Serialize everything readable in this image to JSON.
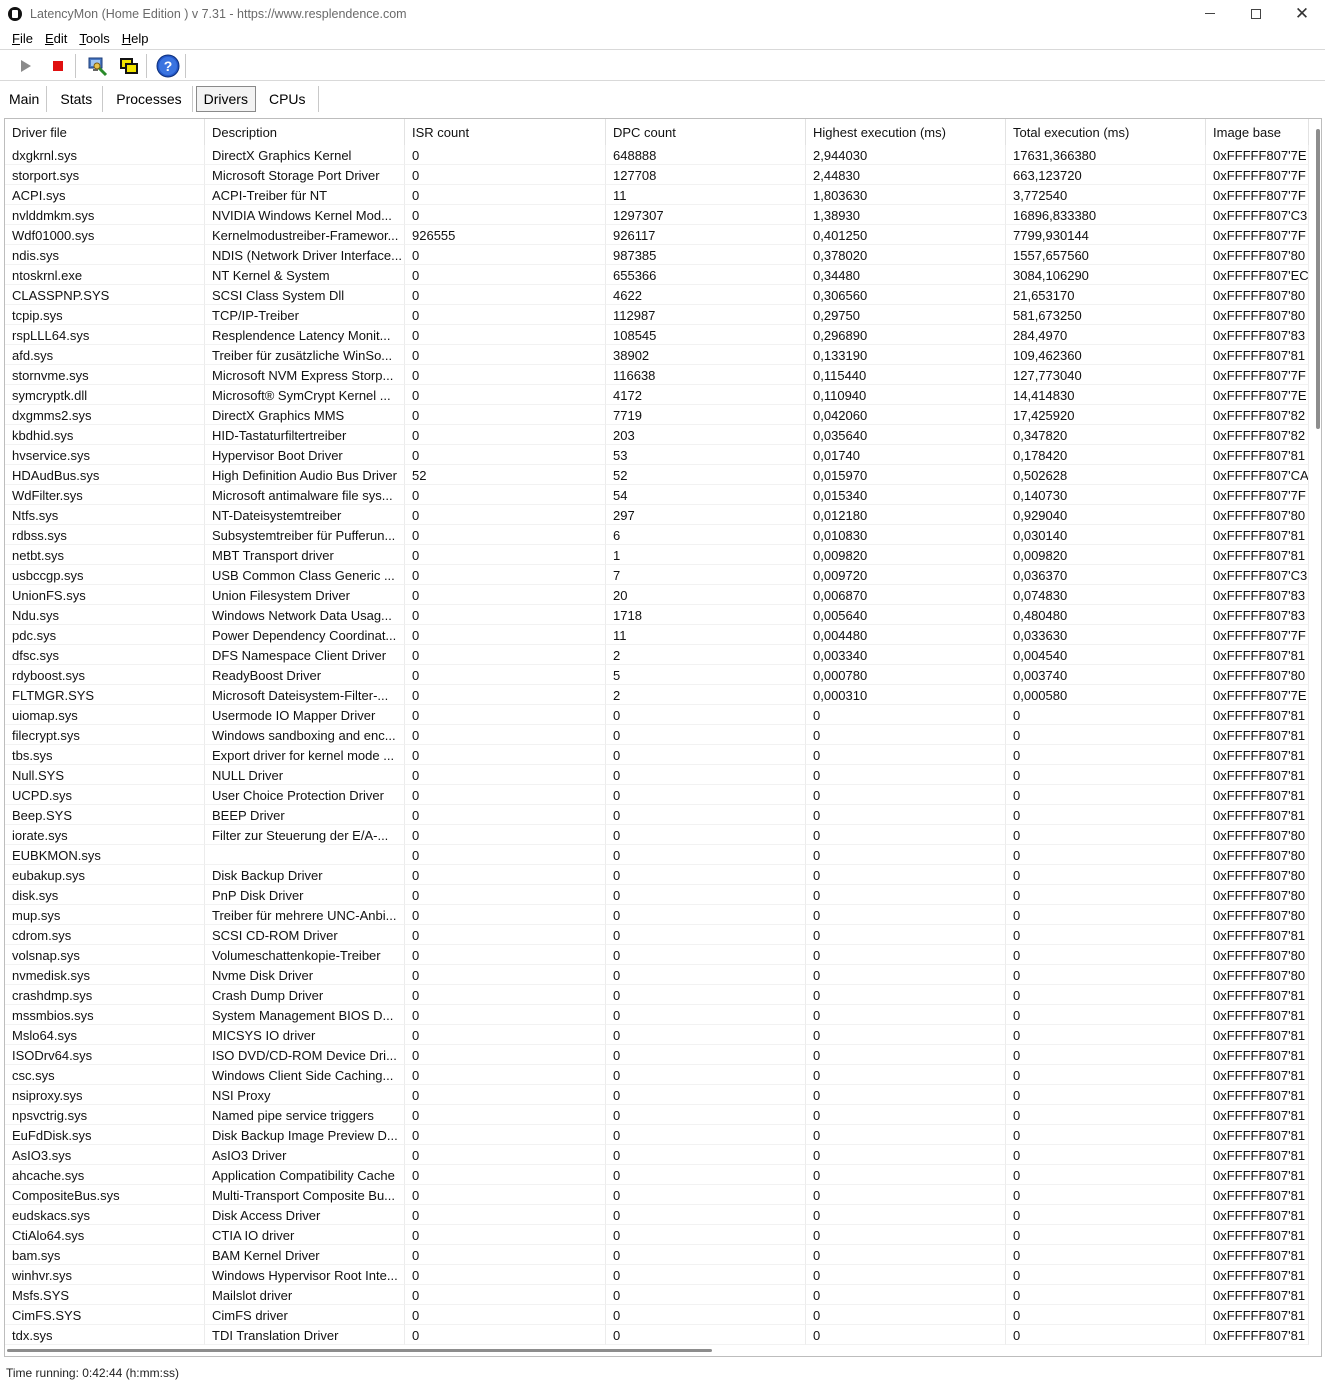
{
  "window": {
    "title": "LatencyMon  (Home Edition )  v 7.31 - https://www.resplendence.com"
  },
  "menu": [
    {
      "label": "File",
      "key": "F",
      "rest": "ile"
    },
    {
      "label": "Edit",
      "key": "E",
      "rest": "dit"
    },
    {
      "label": "Tools",
      "key": "T",
      "rest": "ools"
    },
    {
      "label": "Help",
      "key": "H",
      "rest": "elp"
    }
  ],
  "toolbar": {
    "icons": [
      "play-icon",
      "stop-icon",
      "collect-info-icon",
      "windows-icon",
      "help-icon"
    ]
  },
  "tabs": [
    {
      "label": "Main",
      "active": false
    },
    {
      "label": "Stats",
      "active": false
    },
    {
      "label": "Processes",
      "active": false
    },
    {
      "label": "Drivers",
      "active": true
    },
    {
      "label": "CPUs",
      "active": false
    }
  ],
  "table": {
    "columns": [
      "Driver file",
      "Description",
      "ISR count",
      "DPC count",
      "Highest execution (ms)",
      "Total execution (ms)",
      "Image base"
    ],
    "rows": [
      [
        "dxgkrnl.sys",
        "DirectX Graphics Kernel",
        "0",
        "648888",
        "2,944030",
        "17631,366380",
        "0xFFFFF807'7E"
      ],
      [
        "storport.sys",
        "Microsoft Storage Port Driver",
        "0",
        "127708",
        "2,44830",
        "663,123720",
        "0xFFFFF807'7F"
      ],
      [
        "ACPI.sys",
        "ACPI-Treiber für NT",
        "0",
        "11",
        "1,803630",
        "3,772540",
        "0xFFFFF807'7F"
      ],
      [
        "nvlddmkm.sys",
        "NVIDIA Windows Kernel Mod...",
        "0",
        "1297307",
        "1,38930",
        "16896,833380",
        "0xFFFFF807'C3"
      ],
      [
        "Wdf01000.sys",
        "Kernelmodustreiber-Framewor...",
        "926555",
        "926117",
        "0,401250",
        "7799,930144",
        "0xFFFFF807'7F"
      ],
      [
        "ndis.sys",
        "NDIS (Network Driver Interface...",
        "0",
        "987385",
        "0,378020",
        "1557,657560",
        "0xFFFFF807'80"
      ],
      [
        "ntoskrnl.exe",
        "NT Kernel & System",
        "0",
        "655366",
        "0,34480",
        "3084,106290",
        "0xFFFFF807'EC"
      ],
      [
        "CLASSPNP.SYS",
        "SCSI Class System Dll",
        "0",
        "4622",
        "0,306560",
        "21,653170",
        "0xFFFFF807'80"
      ],
      [
        "tcpip.sys",
        "TCP/IP-Treiber",
        "0",
        "112987",
        "0,29750",
        "581,673250",
        "0xFFFFF807'80"
      ],
      [
        "rspLLL64.sys",
        "Resplendence Latency Monit...",
        "0",
        "108545",
        "0,296890",
        "284,4970",
        "0xFFFFF807'83"
      ],
      [
        "afd.sys",
        "Treiber für zusätzliche WinSo...",
        "0",
        "38902",
        "0,133190",
        "109,462360",
        "0xFFFFF807'81"
      ],
      [
        "stornvme.sys",
        "Microsoft NVM Express Storp...",
        "0",
        "116638",
        "0,115440",
        "127,773040",
        "0xFFFFF807'7F"
      ],
      [
        "symcryptk.dll",
        "Microsoft® SymCrypt Kernel ...",
        "0",
        "4172",
        "0,110940",
        "14,414830",
        "0xFFFFF807'7E"
      ],
      [
        "dxgmms2.sys",
        "DirectX Graphics MMS",
        "0",
        "7719",
        "0,042060",
        "17,425920",
        "0xFFFFF807'82"
      ],
      [
        "kbdhid.sys",
        "HID-Tastaturfiltertreiber",
        "0",
        "203",
        "0,035640",
        "0,347820",
        "0xFFFFF807'82"
      ],
      [
        "hvservice.sys",
        "Hypervisor Boot Driver",
        "0",
        "53",
        "0,01740",
        "0,178420",
        "0xFFFFF807'81"
      ],
      [
        "HDAudBus.sys",
        "High Definition Audio Bus Driver",
        "52",
        "52",
        "0,015970",
        "0,502628",
        "0xFFFFF807'CA"
      ],
      [
        "WdFilter.sys",
        "Microsoft antimalware file sys...",
        "0",
        "54",
        "0,015340",
        "0,140730",
        "0xFFFFF807'7F"
      ],
      [
        "Ntfs.sys",
        "NT-Dateisystemtreiber",
        "0",
        "297",
        "0,012180",
        "0,929040",
        "0xFFFFF807'80"
      ],
      [
        "rdbss.sys",
        "Subsystemtreiber für Pufferun...",
        "0",
        "6",
        "0,010830",
        "0,030140",
        "0xFFFFF807'81"
      ],
      [
        "netbt.sys",
        "MBT Transport driver",
        "0",
        "1",
        "0,009820",
        "0,009820",
        "0xFFFFF807'81"
      ],
      [
        "usbccgp.sys",
        "USB Common Class Generic ...",
        "0",
        "7",
        "0,009720",
        "0,036370",
        "0xFFFFF807'C3"
      ],
      [
        "UnionFS.sys",
        "Union Filesystem Driver",
        "0",
        "20",
        "0,006870",
        "0,074830",
        "0xFFFFF807'83"
      ],
      [
        "Ndu.sys",
        "Windows Network Data Usag...",
        "0",
        "1718",
        "0,005640",
        "0,480480",
        "0xFFFFF807'83"
      ],
      [
        "pdc.sys",
        "Power Dependency Coordinat...",
        "0",
        "11",
        "0,004480",
        "0,033630",
        "0xFFFFF807'7F"
      ],
      [
        "dfsc.sys",
        "DFS Namespace Client Driver",
        "0",
        "2",
        "0,003340",
        "0,004540",
        "0xFFFFF807'81"
      ],
      [
        "rdyboost.sys",
        "ReadyBoost Driver",
        "0",
        "5",
        "0,000780",
        "0,003740",
        "0xFFFFF807'80"
      ],
      [
        "FLTMGR.SYS",
        "Microsoft Dateisystem-Filter-...",
        "0",
        "2",
        "0,000310",
        "0,000580",
        "0xFFFFF807'7E"
      ],
      [
        "uiomap.sys",
        "Usermode IO Mapper Driver",
        "0",
        "0",
        "0",
        "0",
        "0xFFFFF807'81"
      ],
      [
        "filecrypt.sys",
        "Windows sandboxing and enc...",
        "0",
        "0",
        "0",
        "0",
        "0xFFFFF807'81"
      ],
      [
        "tbs.sys",
        "Export driver for kernel mode ...",
        "0",
        "0",
        "0",
        "0",
        "0xFFFFF807'81"
      ],
      [
        "Null.SYS",
        "NULL Driver",
        "0",
        "0",
        "0",
        "0",
        "0xFFFFF807'81"
      ],
      [
        "UCPD.sys",
        "User Choice Protection Driver",
        "0",
        "0",
        "0",
        "0",
        "0xFFFFF807'81"
      ],
      [
        "Beep.SYS",
        "BEEP Driver",
        "0",
        "0",
        "0",
        "0",
        "0xFFFFF807'81"
      ],
      [
        "iorate.sys",
        "Filter zur Steuerung der E/A-...",
        "0",
        "0",
        "0",
        "0",
        "0xFFFFF807'80"
      ],
      [
        "EUBKMON.sys",
        "",
        "0",
        "0",
        "0",
        "0",
        "0xFFFFF807'80"
      ],
      [
        "eubakup.sys",
        "Disk Backup Driver",
        "0",
        "0",
        "0",
        "0",
        "0xFFFFF807'80"
      ],
      [
        "disk.sys",
        "PnP Disk Driver",
        "0",
        "0",
        "0",
        "0",
        "0xFFFFF807'80"
      ],
      [
        "mup.sys",
        "Treiber für mehrere UNC-Anbi...",
        "0",
        "0",
        "0",
        "0",
        "0xFFFFF807'80"
      ],
      [
        "cdrom.sys",
        "SCSI CD-ROM Driver",
        "0",
        "0",
        "0",
        "0",
        "0xFFFFF807'81"
      ],
      [
        "volsnap.sys",
        "Volumeschattenkopie-Treiber",
        "0",
        "0",
        "0",
        "0",
        "0xFFFFF807'80"
      ],
      [
        "nvmedisk.sys",
        "Nvme Disk Driver",
        "0",
        "0",
        "0",
        "0",
        "0xFFFFF807'80"
      ],
      [
        "crashdmp.sys",
        "Crash Dump Driver",
        "0",
        "0",
        "0",
        "0",
        "0xFFFFF807'81"
      ],
      [
        "mssmbios.sys",
        "System Management BIOS D...",
        "0",
        "0",
        "0",
        "0",
        "0xFFFFF807'81"
      ],
      [
        "Mslo64.sys",
        "MICSYS IO driver",
        "0",
        "0",
        "0",
        "0",
        "0xFFFFF807'81"
      ],
      [
        "ISODrv64.sys",
        "ISO DVD/CD-ROM Device Dri...",
        "0",
        "0",
        "0",
        "0",
        "0xFFFFF807'81"
      ],
      [
        "csc.sys",
        "Windows Client Side Caching...",
        "0",
        "0",
        "0",
        "0",
        "0xFFFFF807'81"
      ],
      [
        "nsiproxy.sys",
        "NSI Proxy",
        "0",
        "0",
        "0",
        "0",
        "0xFFFFF807'81"
      ],
      [
        "npsvctrig.sys",
        "Named pipe service triggers",
        "0",
        "0",
        "0",
        "0",
        "0xFFFFF807'81"
      ],
      [
        "EuFdDisk.sys",
        "Disk Backup Image Preview D...",
        "0",
        "0",
        "0",
        "0",
        "0xFFFFF807'81"
      ],
      [
        "AsIO3.sys",
        "AsIO3 Driver",
        "0",
        "0",
        "0",
        "0",
        "0xFFFFF807'81"
      ],
      [
        "ahcache.sys",
        "Application Compatibility Cache",
        "0",
        "0",
        "0",
        "0",
        "0xFFFFF807'81"
      ],
      [
        "CompositeBus.sys",
        "Multi-Transport Composite Bu...",
        "0",
        "0",
        "0",
        "0",
        "0xFFFFF807'81"
      ],
      [
        "eudskacs.sys",
        "Disk Access Driver",
        "0",
        "0",
        "0",
        "0",
        "0xFFFFF807'81"
      ],
      [
        "CtiAlo64.sys",
        "CTIA IO driver",
        "0",
        "0",
        "0",
        "0",
        "0xFFFFF807'81"
      ],
      [
        "bam.sys",
        "BAM Kernel Driver",
        "0",
        "0",
        "0",
        "0",
        "0xFFFFF807'81"
      ],
      [
        "winhvr.sys",
        "Windows Hypervisor Root Inte...",
        "0",
        "0",
        "0",
        "0",
        "0xFFFFF807'81"
      ],
      [
        "Msfs.SYS",
        "Mailslot driver",
        "0",
        "0",
        "0",
        "0",
        "0xFFFFF807'81"
      ],
      [
        "CimFS.SYS",
        "CimFS driver",
        "0",
        "0",
        "0",
        "0",
        "0xFFFFF807'81"
      ],
      [
        "tdx.sys",
        "TDI Translation Driver",
        "0",
        "0",
        "0",
        "0",
        "0xFFFFF807'81"
      ]
    ]
  },
  "status": {
    "text": "Time running: 0:42:44  (h:mm:ss)"
  }
}
